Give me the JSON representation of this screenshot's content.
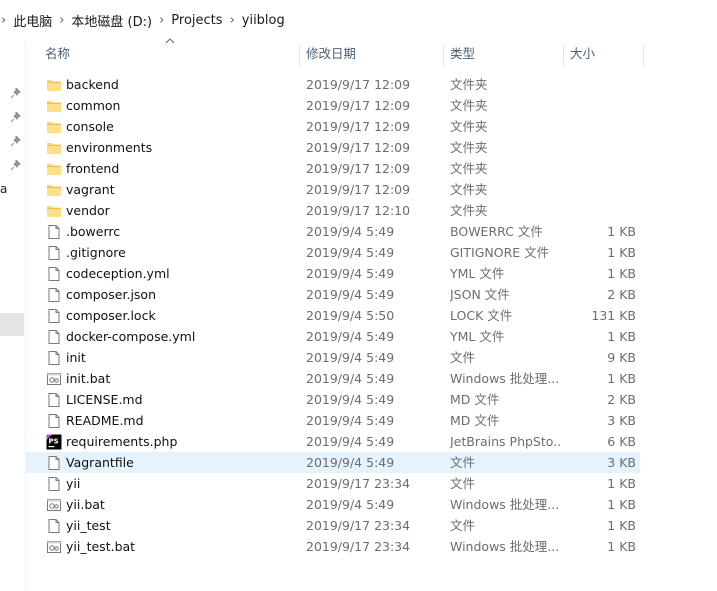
{
  "breadcrumb": [
    "此电脑",
    "本地磁盘 (D:)",
    "Projects",
    "yiiblog"
  ],
  "columns": {
    "name": "名称",
    "date": "修改日期",
    "type": "类型",
    "size": "大小"
  },
  "nav": {
    "letter": "a"
  },
  "files": [
    {
      "name": "backend",
      "date": "2019/9/17 12:09",
      "type": "文件夹",
      "size": "",
      "icon": "folder"
    },
    {
      "name": "common",
      "date": "2019/9/17 12:09",
      "type": "文件夹",
      "size": "",
      "icon": "folder"
    },
    {
      "name": "console",
      "date": "2019/9/17 12:09",
      "type": "文件夹",
      "size": "",
      "icon": "folder"
    },
    {
      "name": "environments",
      "date": "2019/9/17 12:09",
      "type": "文件夹",
      "size": "",
      "icon": "folder"
    },
    {
      "name": "frontend",
      "date": "2019/9/17 12:09",
      "type": "文件夹",
      "size": "",
      "icon": "folder"
    },
    {
      "name": "vagrant",
      "date": "2019/9/17 12:09",
      "type": "文件夹",
      "size": "",
      "icon": "folder"
    },
    {
      "name": "vendor",
      "date": "2019/9/17 12:10",
      "type": "文件夹",
      "size": "",
      "icon": "folder"
    },
    {
      "name": ".bowerrc",
      "date": "2019/9/4 5:49",
      "type": "BOWERRC 文件",
      "size": "1 KB",
      "icon": "file"
    },
    {
      "name": ".gitignore",
      "date": "2019/9/4 5:49",
      "type": "GITIGNORE 文件",
      "size": "1 KB",
      "icon": "file"
    },
    {
      "name": "codeception.yml",
      "date": "2019/9/4 5:49",
      "type": "YML 文件",
      "size": "1 KB",
      "icon": "file"
    },
    {
      "name": "composer.json",
      "date": "2019/9/4 5:49",
      "type": "JSON 文件",
      "size": "2 KB",
      "icon": "file"
    },
    {
      "name": "composer.lock",
      "date": "2019/9/4 5:50",
      "type": "LOCK 文件",
      "size": "131 KB",
      "icon": "file"
    },
    {
      "name": "docker-compose.yml",
      "date": "2019/9/4 5:49",
      "type": "YML 文件",
      "size": "1 KB",
      "icon": "file"
    },
    {
      "name": "init",
      "date": "2019/9/4 5:49",
      "type": "文件",
      "size": "9 KB",
      "icon": "file"
    },
    {
      "name": "init.bat",
      "date": "2019/9/4 5:49",
      "type": "Windows 批处理...",
      "size": "1 KB",
      "icon": "bat"
    },
    {
      "name": "LICENSE.md",
      "date": "2019/9/4 5:49",
      "type": "MD 文件",
      "size": "2 KB",
      "icon": "file"
    },
    {
      "name": "README.md",
      "date": "2019/9/4 5:49",
      "type": "MD 文件",
      "size": "3 KB",
      "icon": "file"
    },
    {
      "name": "requirements.php",
      "date": "2019/9/4 5:49",
      "type": "JetBrains PhpSto...",
      "size": "6 KB",
      "icon": "phpstorm"
    },
    {
      "name": "Vagrantfile",
      "date": "2019/9/4 5:49",
      "type": "文件",
      "size": "3 KB",
      "icon": "file",
      "highlight": true
    },
    {
      "name": "yii",
      "date": "2019/9/17 23:34",
      "type": "文件",
      "size": "1 KB",
      "icon": "file"
    },
    {
      "name": "yii.bat",
      "date": "2019/9/4 5:49",
      "type": "Windows 批处理...",
      "size": "1 KB",
      "icon": "bat"
    },
    {
      "name": "yii_test",
      "date": "2019/9/17 23:34",
      "type": "文件",
      "size": "1 KB",
      "icon": "file"
    },
    {
      "name": "yii_test.bat",
      "date": "2019/9/17 23:34",
      "type": "Windows 批处理...",
      "size": "1 KB",
      "icon": "bat"
    }
  ]
}
